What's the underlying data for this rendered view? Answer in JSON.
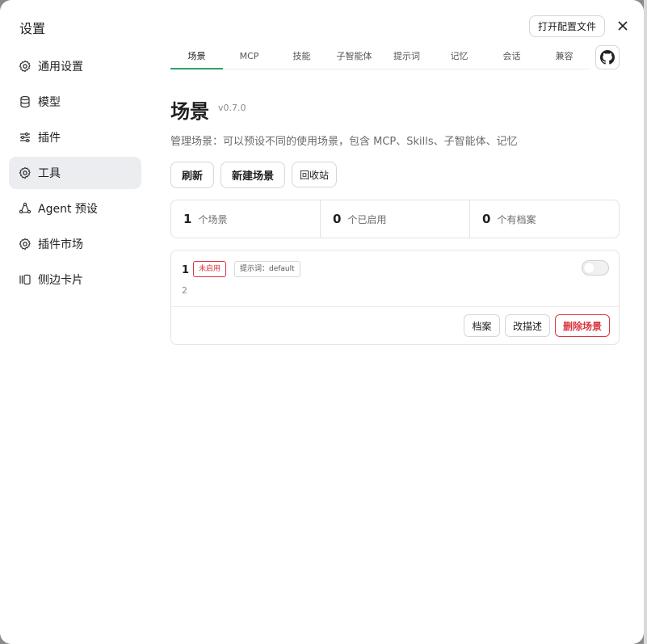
{
  "window": {
    "title": "设置"
  },
  "sidebar": {
    "items": [
      {
        "label": "通用设置",
        "icon": "gear-icon"
      },
      {
        "label": "模型",
        "icon": "database-icon"
      },
      {
        "label": "插件",
        "icon": "sliders-icon"
      },
      {
        "label": "工具",
        "icon": "gear-icon",
        "active": true
      },
      {
        "label": "Agent 预设",
        "icon": "agent-icon"
      },
      {
        "label": "插件市场",
        "icon": "gear-icon"
      },
      {
        "label": "侧边卡片",
        "icon": "sidebar-cards-icon"
      }
    ]
  },
  "header": {
    "open_config_label": "打开配置文件"
  },
  "tabs": [
    {
      "label": "场景",
      "active": true
    },
    {
      "label": "MCP"
    },
    {
      "label": "技能"
    },
    {
      "label": "子智能体"
    },
    {
      "label": "提示词"
    },
    {
      "label": "记忆"
    },
    {
      "label": "会话"
    },
    {
      "label": "兼容"
    }
  ],
  "page": {
    "title": "场景",
    "version": "v0.7.0",
    "description": "管理场景：可以预设不同的使用场景，包含 MCP、Skills、子智能体、记忆"
  },
  "actions": {
    "refresh": "刷新",
    "new_scene": "新建场景",
    "recycle_bin": "回收站"
  },
  "stats": [
    {
      "value": "1",
      "label": "个场景"
    },
    {
      "value": "0",
      "label": "个已启用"
    },
    {
      "value": "0",
      "label": "个有档案"
    }
  ],
  "scene": {
    "name": "1",
    "status_badge": "未启用",
    "prompt_badge": "提示词：default",
    "description": "2",
    "enabled": false,
    "archive_label": "档案",
    "edit_desc_label": "改描述",
    "delete_label": "删除场景"
  },
  "colors": {
    "accent": "#2fa36b",
    "danger": "#d9363e",
    "active_bg": "#ebedf0"
  }
}
